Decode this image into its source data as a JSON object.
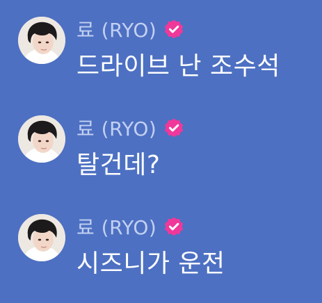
{
  "messages": [
    {
      "sender": "료 (RYO)",
      "text": "드라이브 난 조수석",
      "verified": true
    },
    {
      "sender": "료 (RYO)",
      "text": "탈건데?",
      "verified": true
    },
    {
      "sender": "료 (RYO)",
      "text": "시즈니가 운전",
      "verified": true
    }
  ],
  "colors": {
    "background": "#4d70c2",
    "sender_name": "#c3d0f2",
    "message_text": "#ffffff",
    "verified_badge": "#f0389a"
  },
  "icons": {
    "avatar": "profile-photo",
    "verified": "verified-badge-icon"
  }
}
